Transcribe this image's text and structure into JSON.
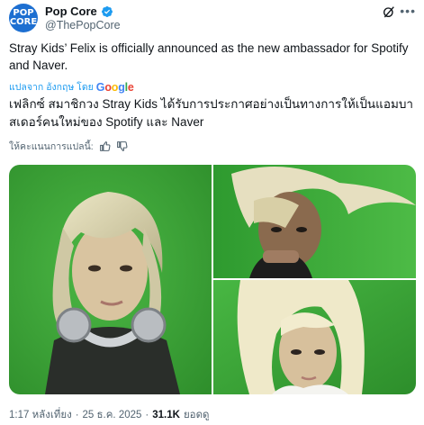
{
  "author": {
    "display_name": "Pop Core",
    "handle": "@ThePopCore",
    "avatar_text": [
      "POP",
      "CORE"
    ],
    "verified": true
  },
  "tweet": {
    "text": "Stray Kids’ Felix is officially announced as the new ambassador for Spotify and Naver.",
    "translated_by_label": "แปลจาก อังกฤษ โดย",
    "translator": "Google",
    "translated_text": "เฟลิกซ์ สมาชิกวง Stray Kids ได้รับการประกาศอย่างเป็นทางการให้เป็นแอมบาสเดอร์คนใหม่ของ Spotify และ Naver",
    "rate_translation_label": "ให้คะแนนการแปลนี้:"
  },
  "meta": {
    "time": "1:17 หลังเที่ยง",
    "date": "25 ธ.ค. 2025",
    "views_count": "31.1K",
    "views_label": "ยอดดู"
  },
  "colors": {
    "accent": "#1d9bf0",
    "muted": "#536471",
    "text": "#0f1419",
    "photo_green": "#3fae3a"
  },
  "icons": [
    "verified-badge-icon",
    "grok-icon",
    "more-icon",
    "thumbs-up-icon",
    "thumbs-down-icon"
  ]
}
